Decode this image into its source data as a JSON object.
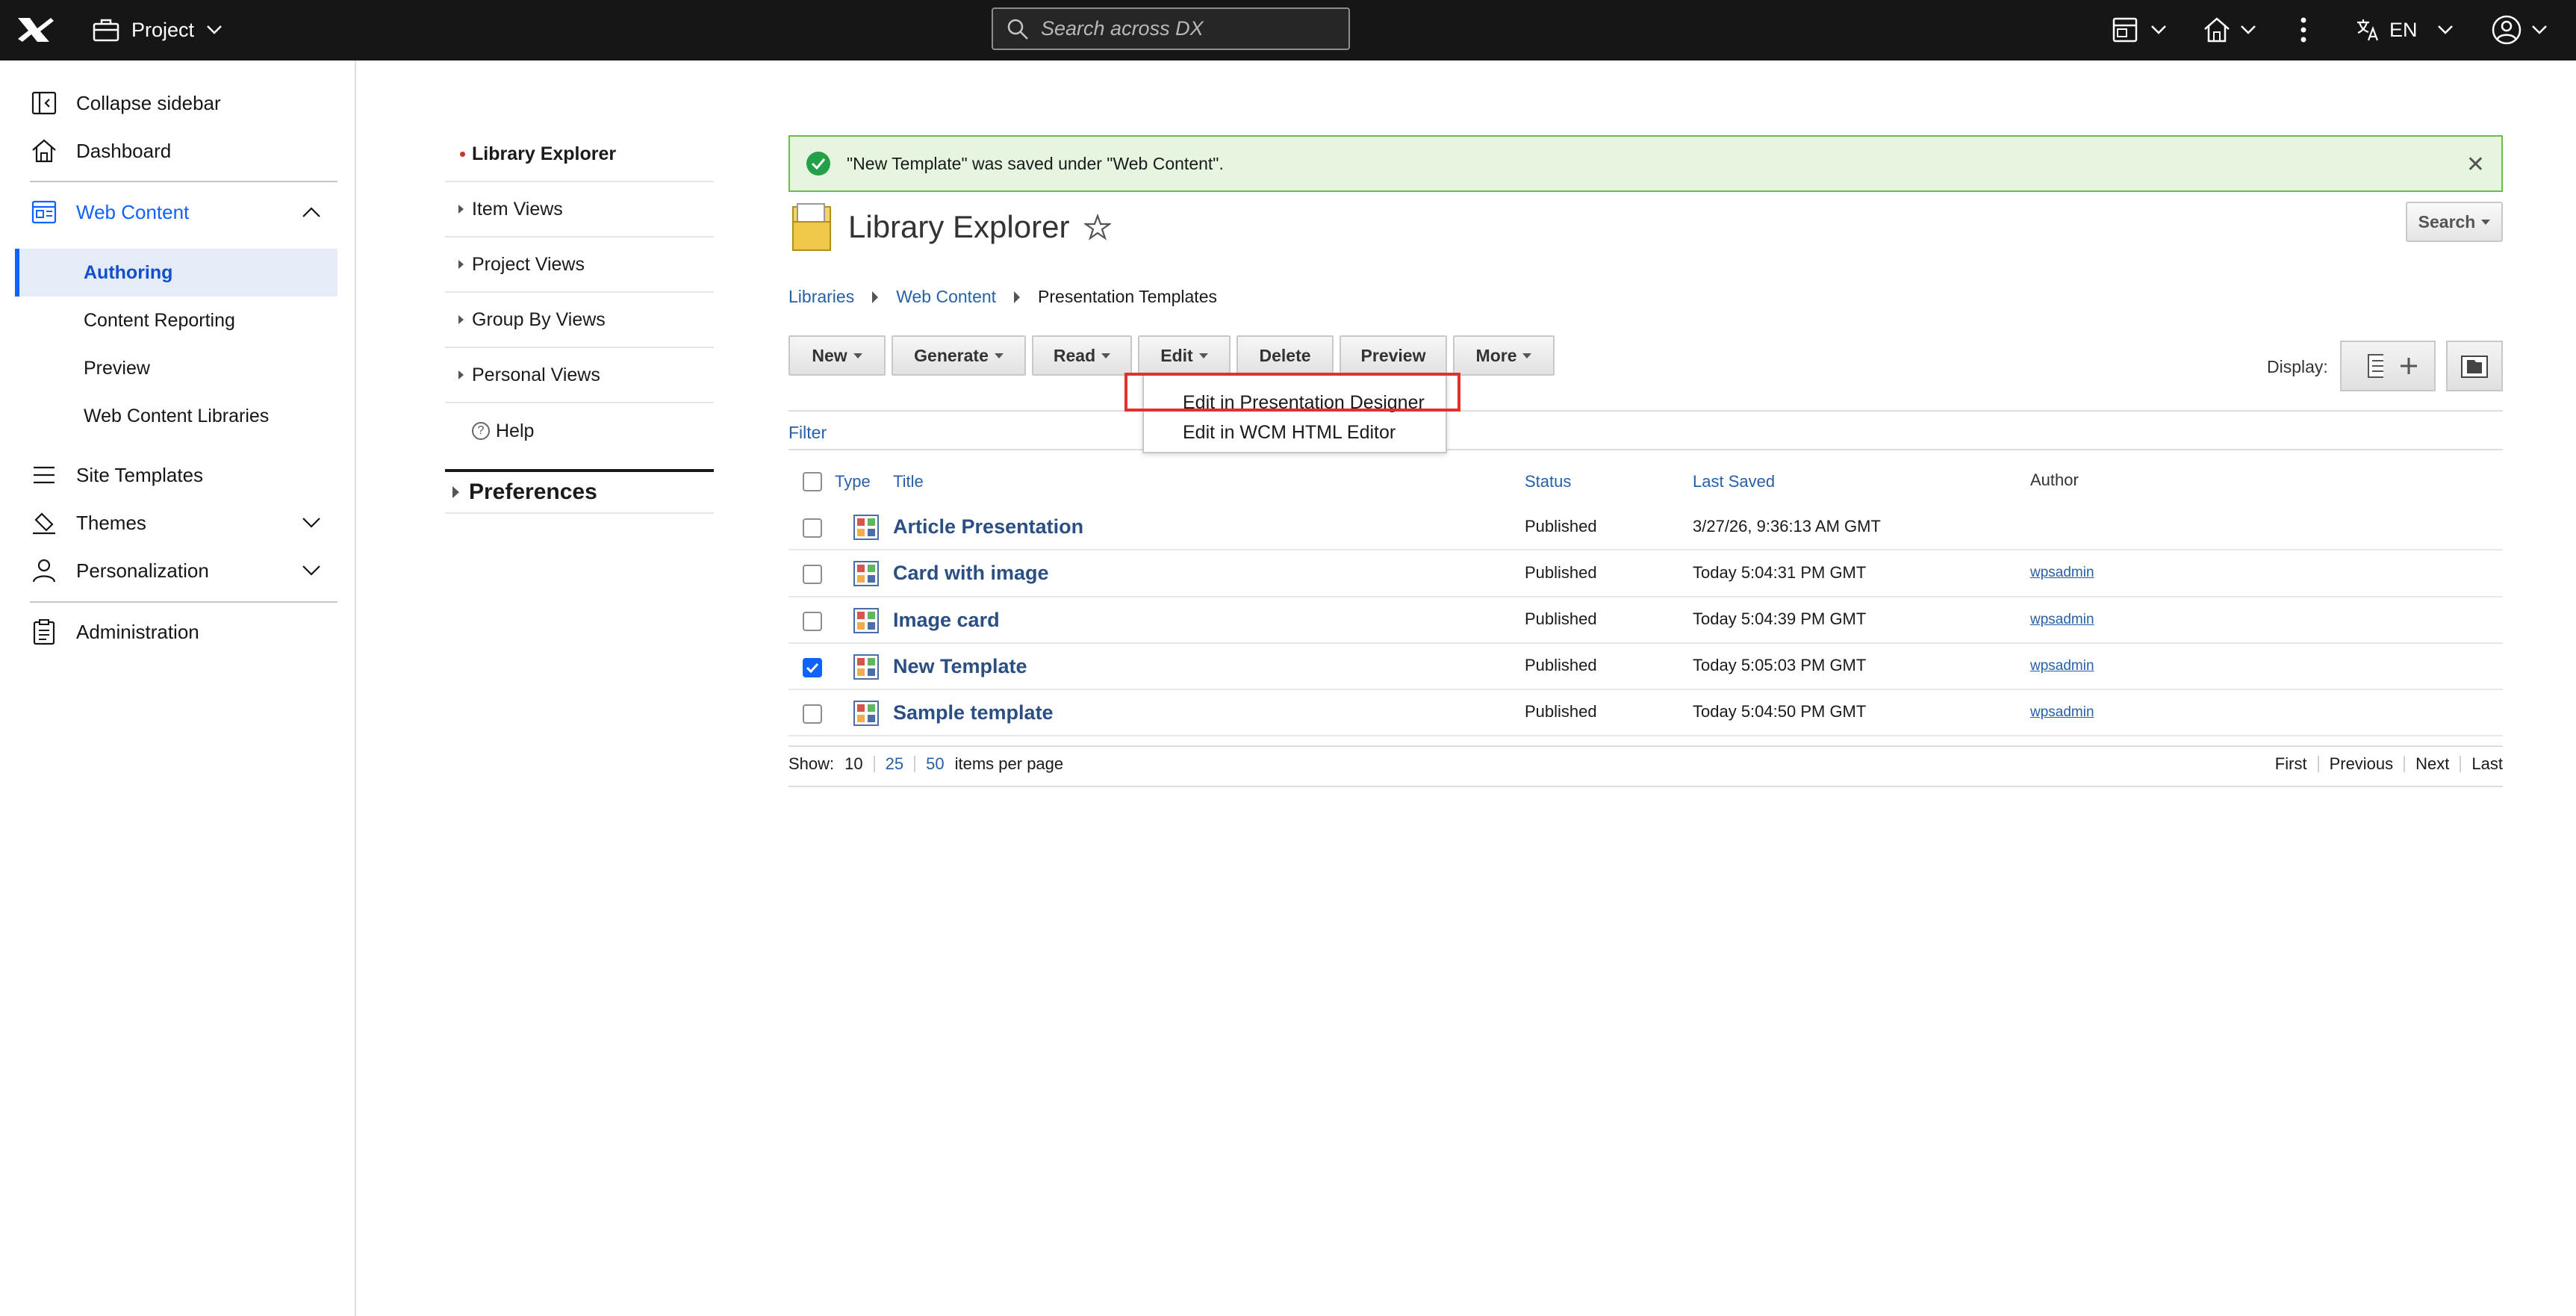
{
  "topbar": {
    "project_label": "Project",
    "search_placeholder": "Search across DX",
    "language": "EN"
  },
  "sidebar": {
    "collapse": "Collapse sidebar",
    "dashboard": "Dashboard",
    "web_content": "Web Content",
    "sub": [
      "Authoring",
      "Content Reporting",
      "Preview",
      "Web Content Libraries"
    ],
    "site_templates": "Site Templates",
    "themes": "Themes",
    "personalization": "Personalization",
    "administration": "Administration"
  },
  "portlet_nav": {
    "items": [
      "Library Explorer",
      "Item Views",
      "Project Views",
      "Group By Views",
      "Personal Views"
    ],
    "help": "Help",
    "preferences": "Preferences"
  },
  "message": "\"New Template\" was saved under \"Web Content\".",
  "page_title": "Library Explorer",
  "search_button": "Search",
  "breadcrumb": [
    "Libraries",
    "Web Content",
    "Presentation Templates"
  ],
  "toolbar": {
    "new": "New",
    "generate": "Generate",
    "read": "Read",
    "edit": "Edit",
    "delete": "Delete",
    "preview": "Preview",
    "more": "More"
  },
  "display_label": "Display:",
  "edit_menu": [
    "Edit in Presentation Designer",
    "Edit in WCM HTML Editor"
  ],
  "filter": "Filter",
  "table": {
    "headers": {
      "type": "Type",
      "title": "Title",
      "status": "Status",
      "last_saved": "Last Saved",
      "author": "Author"
    },
    "rows": [
      {
        "title": "Article Presentation",
        "status": "Published",
        "saved": "3/27/26, 9:36:13 AM GMT",
        "author": "",
        "checked": false
      },
      {
        "title": "Card with image",
        "status": "Published",
        "saved": "Today 5:04:31 PM GMT",
        "author": "wpsadmin",
        "checked": false
      },
      {
        "title": "Image card",
        "status": "Published",
        "saved": "Today 5:04:39 PM GMT",
        "author": "wpsadmin",
        "checked": false
      },
      {
        "title": "New Template",
        "status": "Published",
        "saved": "Today 5:05:03 PM GMT",
        "author": "wpsadmin",
        "checked": true
      },
      {
        "title": "Sample template",
        "status": "Published",
        "saved": "Today 5:04:50 PM GMT",
        "author": "wpsadmin",
        "checked": false
      }
    ]
  },
  "pager": {
    "show": "Show:",
    "sizes": [
      "10",
      "25",
      "50"
    ],
    "per_page": "items per page",
    "first": "First",
    "previous": "Previous",
    "next": "Next",
    "last": "Last"
  },
  "colors": {
    "accent": "#0f62fe",
    "topbar": "#161616",
    "success_bg": "#e6f5df",
    "highlight": "#e0312b",
    "link": "#2760a8"
  }
}
